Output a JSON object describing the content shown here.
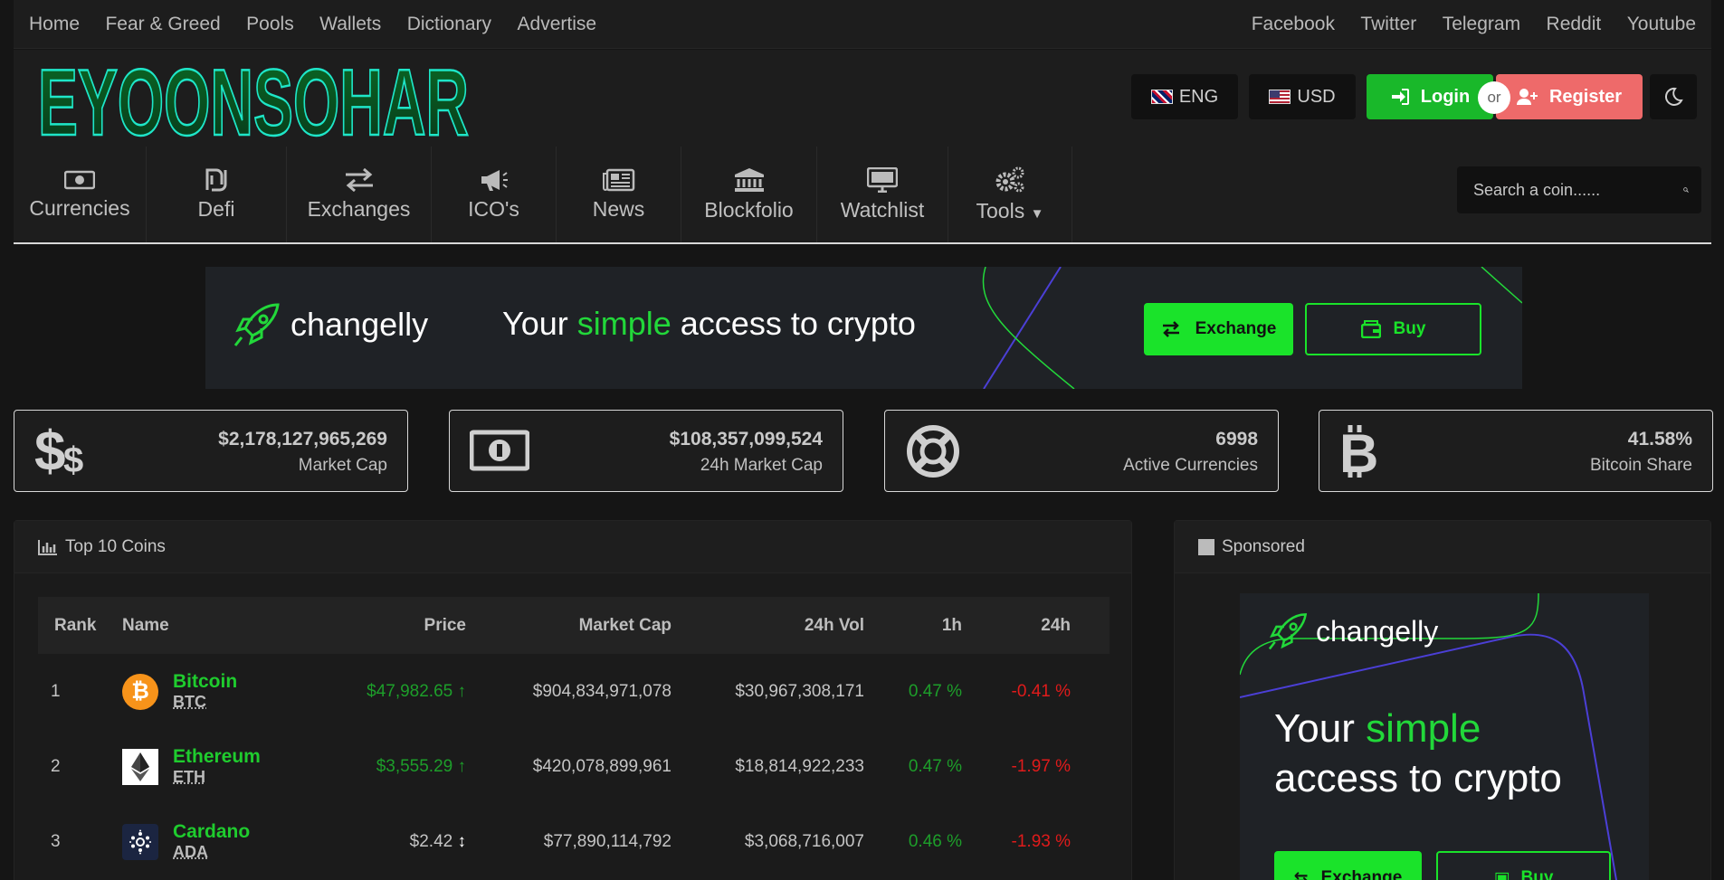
{
  "topnav": {
    "left": [
      "Home",
      "Fear & Greed",
      "Pools",
      "Wallets",
      "Dictionary",
      "Advertise"
    ],
    "right": [
      "Facebook",
      "Twitter",
      "Telegram",
      "Reddit",
      "Youtube"
    ]
  },
  "header": {
    "logo_text": "EYOONSOHAR",
    "language": "ENG",
    "currency": "USD",
    "login": "Login",
    "or": "or",
    "register": "Register"
  },
  "nav": {
    "items": [
      {
        "label": "Currencies",
        "icon": "banknote-icon"
      },
      {
        "label": "Defi",
        "icon": "shekel-icon"
      },
      {
        "label": "Exchanges",
        "icon": "exchange-arrows-icon"
      },
      {
        "label": "ICO's",
        "icon": "megaphone-icon"
      },
      {
        "label": "News",
        "icon": "newspaper-icon"
      },
      {
        "label": "Blockfolio",
        "icon": "bank-icon"
      },
      {
        "label": "Watchlist",
        "icon": "monitor-icon"
      },
      {
        "label": "Tools",
        "icon": "gears-icon"
      }
    ],
    "search_placeholder": "Search a coin......"
  },
  "banner": {
    "brand": "changelly",
    "tag_pre": "Your ",
    "tag_hl": "simple",
    "tag_post": " access to crypto",
    "exchange": "Exchange",
    "buy": "Buy"
  },
  "stats": [
    {
      "value": "$2,178,127,965,269",
      "label": "Market Cap",
      "icon": "dollars-icon"
    },
    {
      "value": "$108,357,099,524",
      "label": "24h Market Cap",
      "icon": "banknote-icon"
    },
    {
      "value": "6998",
      "label": "Active Currencies",
      "icon": "lifering-icon"
    },
    {
      "value": "41.58%",
      "label": "Bitcoin Share",
      "icon": "bitcoin-icon"
    }
  ],
  "top10": {
    "title": "Top 10 Coins",
    "columns": [
      "Rank",
      "Name",
      "Price",
      "Market Cap",
      "24h Vol",
      "1h",
      "24h"
    ],
    "rows": [
      {
        "rank": "1",
        "name": "Bitcoin",
        "symbol": "BTC",
        "price": "$47,982.65",
        "trend": "up",
        "mcap": "$904,834,971,078",
        "vol": "$30,967,308,171",
        "h1": "0.47 %",
        "h24": "-0.41 %"
      },
      {
        "rank": "2",
        "name": "Ethereum",
        "symbol": "ETH",
        "price": "$3,555.29",
        "trend": "up",
        "mcap": "$420,078,899,961",
        "vol": "$18,814,922,233",
        "h1": "0.47 %",
        "h24": "-1.97 %"
      },
      {
        "rank": "3",
        "name": "Cardano",
        "symbol": "ADA",
        "price": "$2.42",
        "trend": "flat",
        "mcap": "$77,890,114,792",
        "vol": "$3,068,716,007",
        "h1": "0.46 %",
        "h24": "-1.93 %"
      }
    ]
  },
  "sponsored": {
    "title": "Sponsored",
    "brand": "changelly",
    "line1_pre": "Your ",
    "line1_hl": "simple",
    "line2": "access to crypto",
    "exchange": "Exchange",
    "buy": "Buy"
  }
}
